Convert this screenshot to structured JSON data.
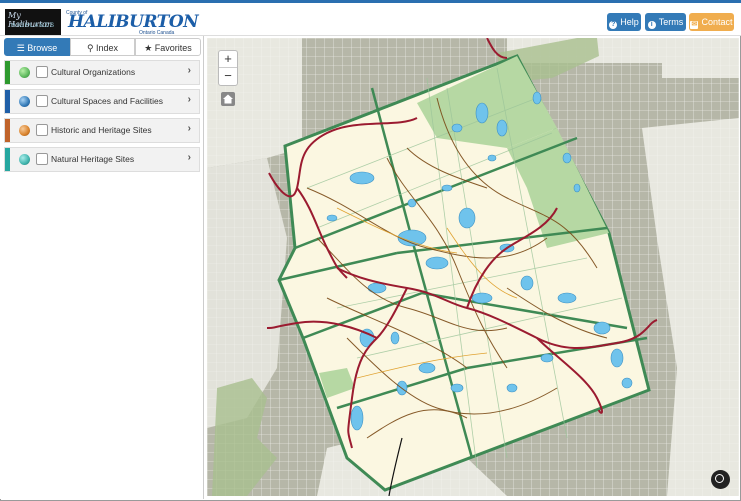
{
  "header": {
    "logo_mh_line1": "My Haliburton",
    "logo_mh_line2": "HIGHLANDS",
    "logo_h_small": "County of",
    "logo_h_big": "HALIBURTON",
    "logo_h_sub": "Ontario Canada",
    "buttons": {
      "help": "Help",
      "terms": "Terms",
      "contact": "Contact"
    }
  },
  "sidebar": {
    "tabs": [
      {
        "label": "Browse",
        "icon": "list-icon"
      },
      {
        "label": "Index",
        "icon": "search-icon"
      },
      {
        "label": "Favorites",
        "icon": "star-icon"
      }
    ],
    "categories": [
      {
        "label": "Cultural Organizations",
        "color": "#5cb85c",
        "bar": "#2e9a2e"
      },
      {
        "label": "Cultural Spaces and Facilities",
        "color": "#337ab7",
        "bar": "#1f5fa8"
      },
      {
        "label": "Historic and Heritage Sites",
        "color": "#d9822b",
        "bar": "#c0632a"
      },
      {
        "label": "Natural Heritage Sites",
        "color": "#3fb4ad",
        "bar": "#26a7a0"
      }
    ]
  },
  "map": {
    "zoom_in": "+",
    "zoom_out": "−",
    "colors": {
      "land": "#fbf7e1",
      "park": "#b6d8a3",
      "outer": "#b6b7a8",
      "grid": "#ffffff",
      "water": "#6fc3ec",
      "highway": "#9b1b30",
      "road": "#7a4a16",
      "township_border": "#3f8a55"
    }
  }
}
